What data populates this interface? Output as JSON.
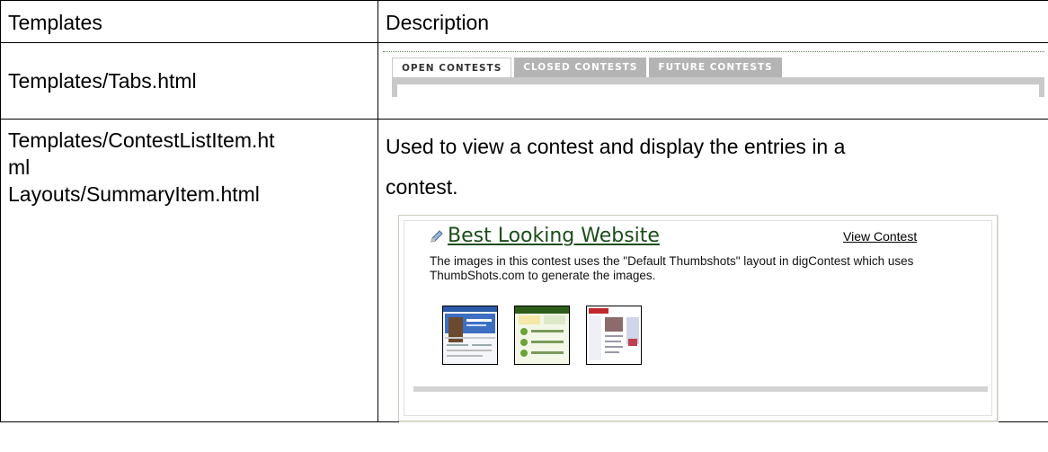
{
  "table": {
    "header": {
      "col1": "Templates",
      "col2": "Description"
    },
    "row1": {
      "template": "Templates/Tabs.html"
    },
    "row2": {
      "template_line1": "Templates/ContestListItem.ht",
      "template_line2": "ml",
      "template_line3": "Layouts/SummaryItem.html",
      "description_line1": "Used to view a contest and display the entries in a",
      "description_line2": "contest."
    }
  },
  "tabs_mockup": {
    "tabs": [
      "OPEN CONTESTS",
      "CLOSED CONTESTS",
      "FUTURE CONTESTS"
    ],
    "active_index": 0
  },
  "contest_mockup": {
    "title": "Best Looking Website",
    "view_link": "View Contest",
    "description": "The images in this contest uses the \"Default Thumbshots\" layout in digContest which uses ThumbShots.com to generate the images.",
    "thumbnails": [
      "microsoft-site-thumbnail",
      "digg-site-thumbnail",
      "yahoo-site-thumbnail"
    ],
    "colors": {
      "title": "#1a4d1a",
      "inactive_tab": "#b4b4b4"
    }
  }
}
